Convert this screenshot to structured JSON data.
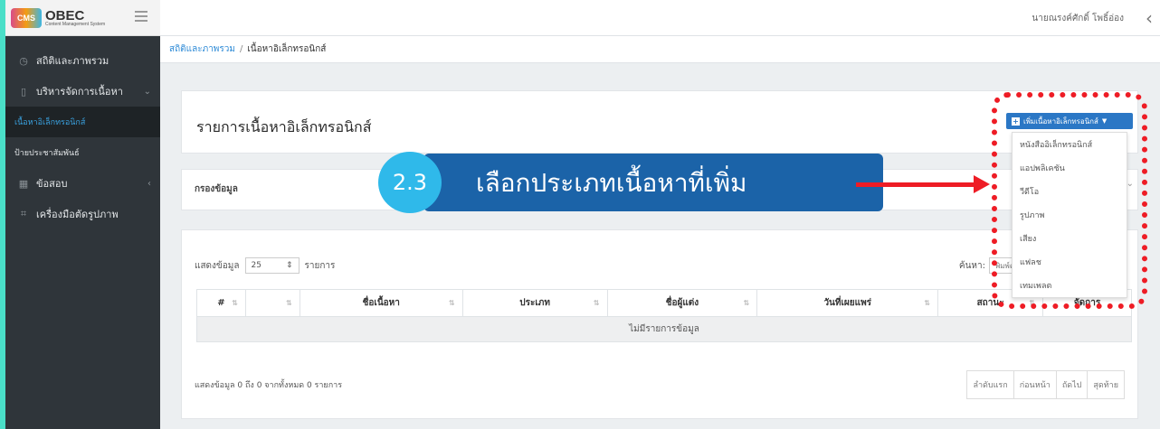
{
  "logo": {
    "badge": "CMS",
    "title": "OBEC",
    "subtitle": "Content Management System"
  },
  "topbar": {
    "user_name": "นายณรงค์ศักดิ์ โพธิ์อ่อง"
  },
  "sidebar": {
    "items": [
      {
        "label": "สถิติและภาพรวม"
      },
      {
        "label": "บริหารจัดการเนื้อหา"
      },
      {
        "label": "เนื้อหาอิเล็กทรอนิกส์"
      },
      {
        "label": "ป้ายประชาสัมพันธ์"
      },
      {
        "label": "ข้อสอบ"
      },
      {
        "label": "เครื่องมือตัดรูปภาพ"
      }
    ]
  },
  "breadcrumb": {
    "root": "สถิติและภาพรวม",
    "sep": "/",
    "current": "เนื้อหาอิเล็กทรอนิกส์"
  },
  "main": {
    "title": "รายการเนื้อหาอิเล็กทรอนิกส์",
    "add_button": "เพิ่มเนื้อหาอิเล็กทรอนิกส์",
    "dropdown_options": [
      "หนังสืออิเล็กทรอนิกส์",
      "แอปพลิเคชัน",
      "วีดีโอ",
      "รูปภาพ",
      "เสียง",
      "แฟลช",
      "เทมเพลต"
    ],
    "filter_label": "กรองข้อมูล"
  },
  "table": {
    "show_prefix": "แสดงข้อมูล",
    "page_size": "25",
    "show_suffix": "รายการ",
    "search_label": "ค้นหา:",
    "search_placeholder": "พิมพ์คำค้นหาที่นี่",
    "headers": [
      "#",
      "",
      "ชื่อเนื้อหา",
      "ประเภท",
      "ชื่อผู้แต่ง",
      "วันที่เผยแพร่",
      "สถานะ",
      "จัดการ"
    ],
    "empty_text": "ไม่มีรายการข้อมูล",
    "info": "แสดงข้อมูล 0 ถึง 0 จากทั้งหมด 0 รายการ",
    "pager": [
      "ลำดับแรก",
      "ก่อนหน้า",
      "ถัดไป",
      "สุดท้าย"
    ]
  },
  "annotation": {
    "step": "2.3",
    "text": "เลือกประเภทเนื้อหาที่เพิ่ม"
  },
  "colors": {
    "sidebar": "#2f353a",
    "accent": "#2b77c5",
    "annotation_bar": "#1b63a8",
    "annotation_circle": "#2fb9ea",
    "highlight": "#ee1c25"
  }
}
